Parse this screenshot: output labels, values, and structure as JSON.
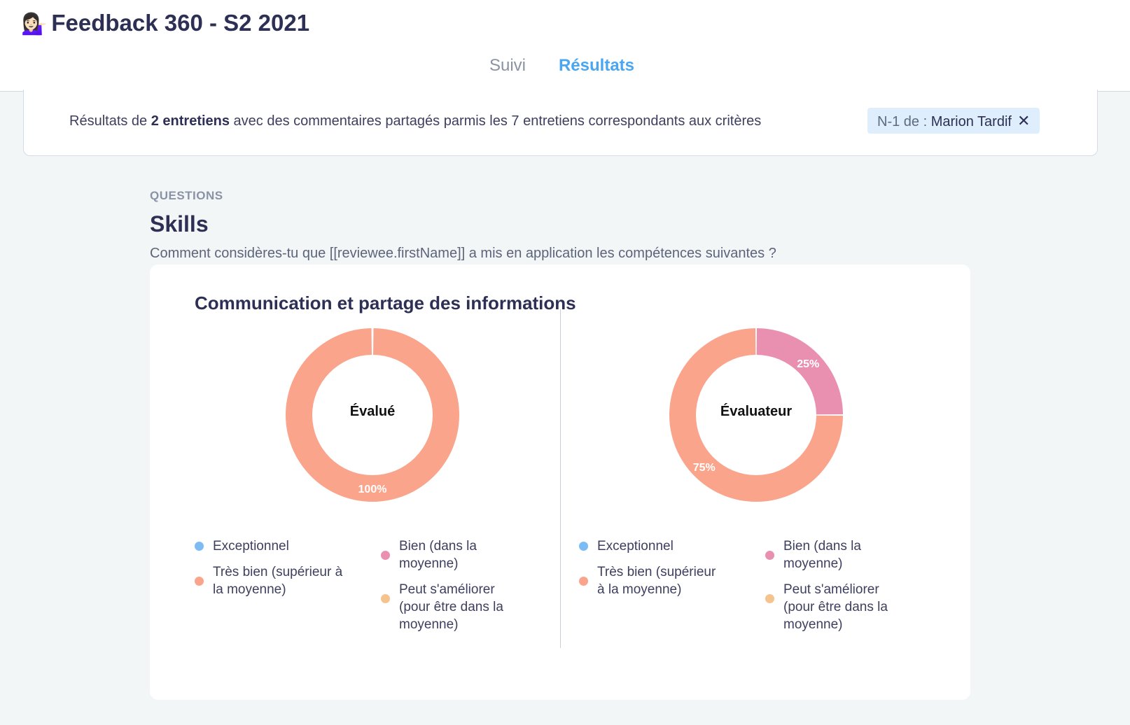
{
  "header": {
    "emoji": "💁🏻‍♀️",
    "title": "Feedback 360 - S2 2021",
    "tabs": [
      {
        "label": "Suivi"
      },
      {
        "label": "Résultats"
      }
    ]
  },
  "banner": {
    "prefix": "Résultats de ",
    "count": "2 entretiens",
    "suffix": " avec des commentaires partagés parmis les 7 entretiens correspondants aux critères",
    "filter": {
      "key": "N-1 de : ",
      "value": "Marion Tardif",
      "close": "✕"
    }
  },
  "section": {
    "label": "QUESTIONS",
    "title": "Skills",
    "description": "Comment considères-tu que [[reviewee.firstName]] a mis en application les compétences suivantes ?"
  },
  "card": {
    "title": "Communication et partage des informations"
  },
  "colors": {
    "exceptionnel": "#7cbcf4",
    "tres_bien": "#fba48c",
    "bien": "#e98fb0",
    "ameliorer": "#f5c48e"
  },
  "chart_data": [
    {
      "type": "pie",
      "center_label": "Évalué",
      "slices": [
        {
          "name": "Exceptionnel",
          "value": 0
        },
        {
          "name": "Très bien (supérieur à la moyenne)",
          "value": 100,
          "label": "100%"
        },
        {
          "name": "Bien (dans la moyenne)",
          "value": 0
        },
        {
          "name": "Peut s'améliorer (pour être dans la moyenne)",
          "value": 0
        }
      ],
      "legend": [
        [
          "Exceptionnel"
        ],
        [
          "Très bien (supérieur à",
          "la moyenne)"
        ],
        [
          "Bien (dans la",
          "moyenne)"
        ],
        [
          "Peut s'améliorer",
          "(pour être dans la",
          "moyenne)"
        ]
      ]
    },
    {
      "type": "pie",
      "center_label": "Évaluateur",
      "slices": [
        {
          "name": "Exceptionnel",
          "value": 0
        },
        {
          "name": "Très bien (supérieur à la moyenne)",
          "value": 75,
          "label": "75%"
        },
        {
          "name": "Bien (dans la moyenne)",
          "value": 25,
          "label": "25%"
        },
        {
          "name": "Peut s'améliorer (pour être dans la moyenne)",
          "value": 0
        }
      ],
      "legend": [
        [
          "Exceptionnel"
        ],
        [
          "Très bien (supérieur",
          "à la moyenne)"
        ],
        [
          "Bien (dans la",
          "moyenne)"
        ],
        [
          "Peut s'améliorer",
          "(pour être dans la",
          "moyenne)"
        ]
      ]
    }
  ]
}
